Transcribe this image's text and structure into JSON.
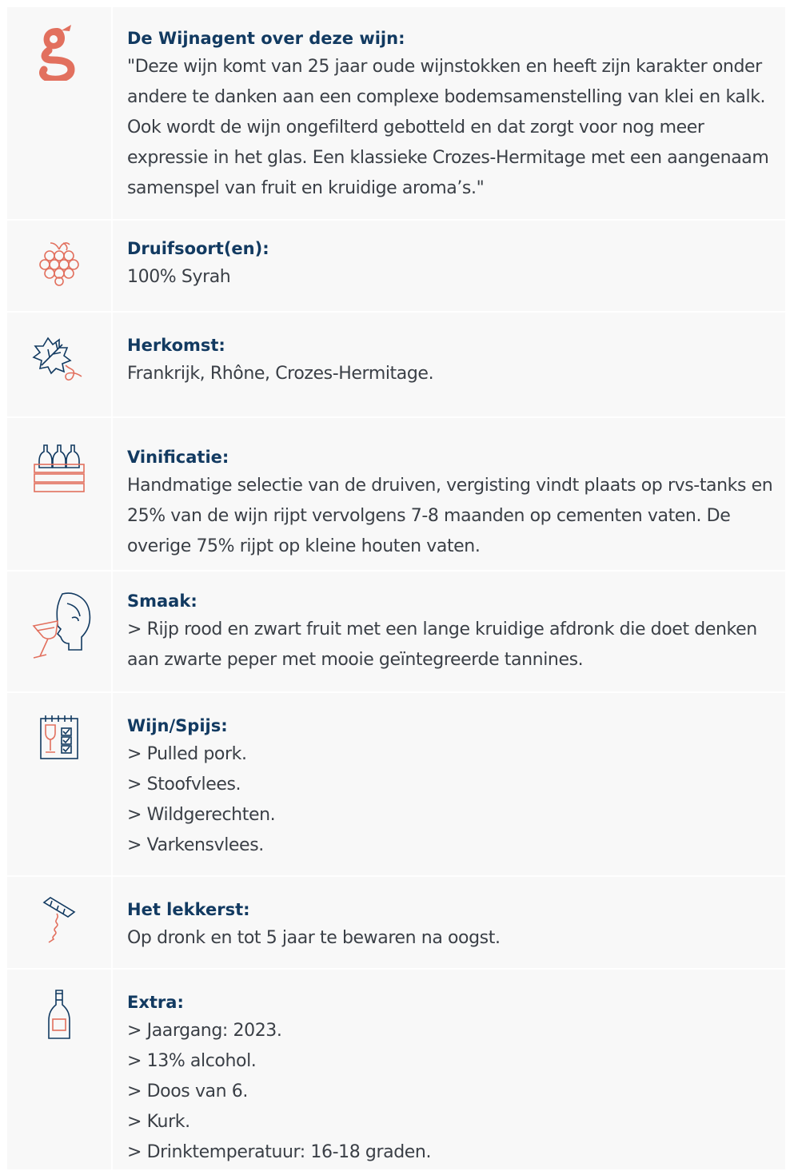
{
  "colors": {
    "heading": "#123a61",
    "text": "#3a3f46",
    "accent": "#e2705e",
    "navy": "#123a61",
    "cell_bg": "#f8f8f8"
  },
  "rows": [
    {
      "icon": "brand-g-logo-icon",
      "heading": "De Wijnagent over deze wijn:",
      "body": "\"Deze wijn komt van 25 jaar oude wijnstokken en heeft zijn karakter onder andere te danken aan een complexe bodemsamenstelling van klei en kalk. Ook wordt de wijn ongefilterd gebotteld en dat zorgt voor nog meer expressie in het glas. Een klassieke Crozes-Hermitage met een aangenaam samenspel van fruit en kruidige aroma’s.\""
    },
    {
      "icon": "grapes-icon",
      "heading": "Druifsoort(en):",
      "body": "100% Syrah"
    },
    {
      "icon": "vine-leaf-icon",
      "heading": "Herkomst:",
      "body": "Frankrijk, Rhône, Crozes-Hermitage."
    },
    {
      "icon": "wine-crate-icon",
      "heading": "Vinificatie:",
      "body": "Handmatige selectie van de druiven, vergisting vindt plaats op rvs-tanks en 25% van de wijn rijpt vervolgens 7-8 maanden op cementen vaten. De overige 75% rijpt op kleine houten vaten."
    },
    {
      "icon": "tasting-face-icon",
      "heading": "Smaak:",
      "body": "> Rijp rood en zwart fruit met een lange kruidige afdronk die doet denken aan zwarte peper met mooie geïntegreerde tannines."
    },
    {
      "icon": "wine-menu-icon",
      "heading": "Wijn/Spijs:",
      "items": [
        "> Pulled pork.",
        "> Stoofvlees.",
        "> Wildgerechten.",
        "> Varkensvlees."
      ]
    },
    {
      "icon": "corkscrew-icon",
      "heading": "Het lekkerst:",
      "body": "Op dronk en tot 5 jaar te bewaren na oogst."
    },
    {
      "icon": "wine-bottle-icon",
      "heading": "Extra:",
      "items": [
        "> Jaargang: 2023.",
        "> 13% alcohol.",
        "> Doos van 6.",
        "> Kurk.",
        "> Drinktemperatuur: 16-18 graden."
      ]
    }
  ]
}
